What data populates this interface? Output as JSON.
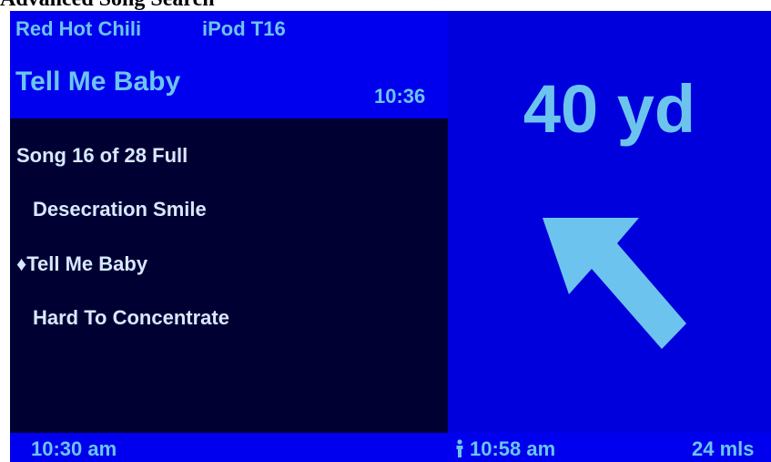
{
  "page": {
    "title": "Advanced Song Search"
  },
  "header": {
    "artist": "Red Hot Chili",
    "source": "iPod T16",
    "song": "Tell Me Baby",
    "time": "10:36"
  },
  "song_list": {
    "status": "Song 16 of 28 Full",
    "items": [
      {
        "label": "Desecration Smile",
        "selected": false
      },
      {
        "label": "♦Tell Me Baby",
        "selected": true
      },
      {
        "label": "Hard To Concentrate",
        "selected": false
      }
    ]
  },
  "navigation": {
    "distance": "40 yd",
    "direction_icon": "arrow-up-left-icon"
  },
  "status_bar": {
    "current_time": "10:30 am",
    "arrival_icon": "person-icon",
    "arrival_time": "10:58 am",
    "remaining_distance": "24 mls"
  },
  "colors": {
    "header_blue": "#0000ee",
    "nav_blue": "#0000dd",
    "list_background": "#000033",
    "accent_light_blue": "#6cc4ee",
    "list_text": "#d8e8ff"
  }
}
